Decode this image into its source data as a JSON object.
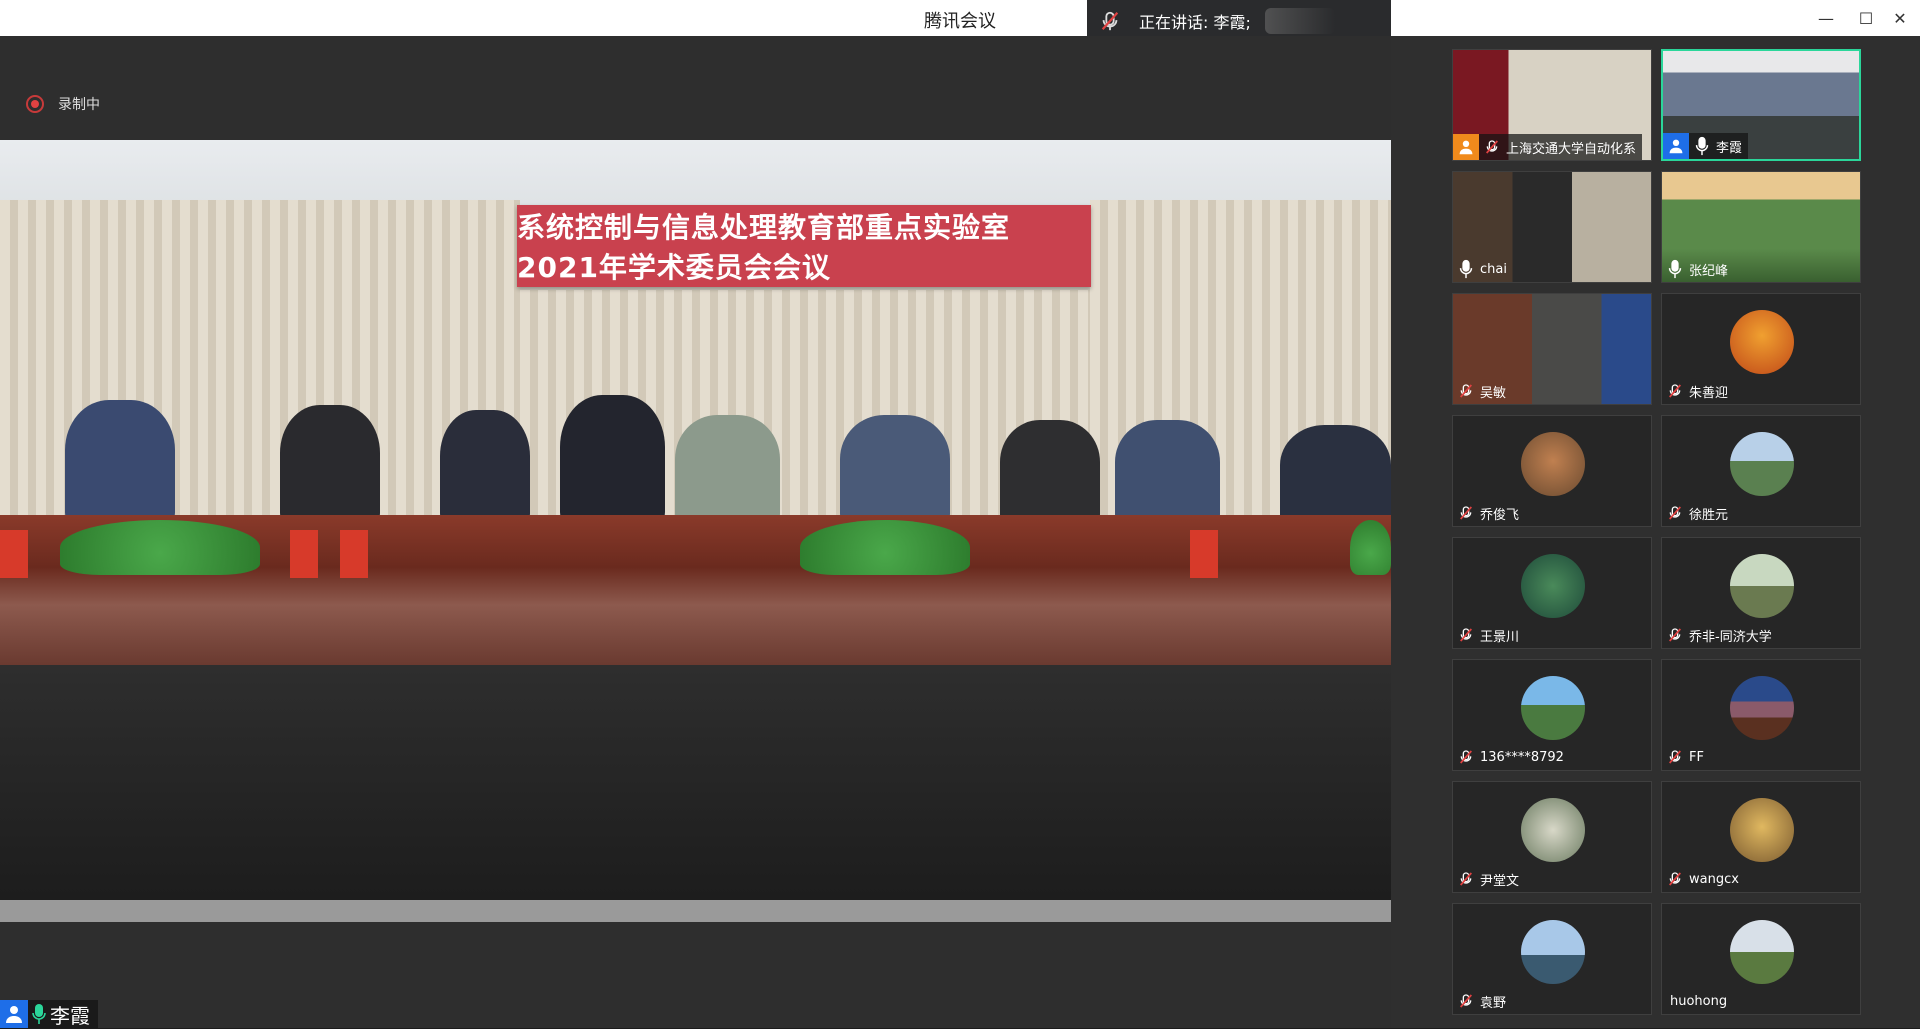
{
  "window": {
    "title": "腾讯会议",
    "minimize": "—",
    "maximize": "☐",
    "close": "✕"
  },
  "speaking": {
    "text": "正在讲话: 李霞;"
  },
  "recording": {
    "label": "录制中"
  },
  "main_video": {
    "banner": "系统控制与信息处理教育部重点实验室2021年学术委员会会议"
  },
  "self_label": {
    "name": "李霞"
  },
  "colors": {
    "accent": "#2bd69a",
    "host_blue": "#1e6ee8",
    "cohost_orange": "#f08a1c",
    "mute_red": "#e04242"
  },
  "participants": [
    {
      "name": "上海交通大学自动化系",
      "muted": true,
      "tag": "orange",
      "video": true
    },
    {
      "name": "李霞",
      "muted": false,
      "tag": "blue",
      "video": true,
      "active": true
    },
    {
      "name": "chai",
      "muted": false,
      "video": true
    },
    {
      "name": "张纪峰",
      "muted": false,
      "video": true
    },
    {
      "name": "吴敏",
      "muted": true,
      "video": true
    },
    {
      "name": "朱善迎",
      "muted": true
    },
    {
      "name": "乔俊飞",
      "muted": true
    },
    {
      "name": "徐胜元",
      "muted": true
    },
    {
      "name": "王景川",
      "muted": true
    },
    {
      "name": "乔非-同济大学",
      "muted": true
    },
    {
      "name": "136****8792",
      "muted": true
    },
    {
      "name": "FF",
      "muted": true
    },
    {
      "name": "尹堂文",
      "muted": true
    },
    {
      "name": "wangcx",
      "muted": true
    },
    {
      "name": "袁野",
      "muted": true
    },
    {
      "name": "huohong",
      "no_mic": true
    }
  ]
}
